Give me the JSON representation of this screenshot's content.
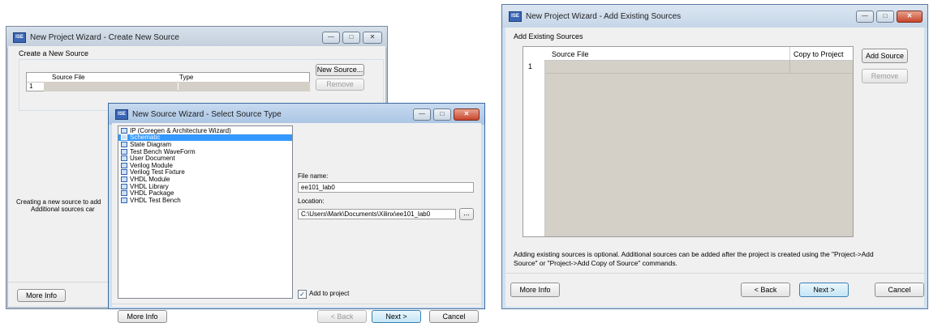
{
  "left_window": {
    "title": "New Project Wizard - Create New Source",
    "section_title": "Create a New Source",
    "table": {
      "row_number": "1",
      "col_source_file": "Source File",
      "col_type": "Type"
    },
    "new_source_label": "New Source...",
    "remove_label": "Remove",
    "info_line1": "Creating a new source to add",
    "info_line2": "Additional sources car",
    "more_info_label": "More Info"
  },
  "source_wizard": {
    "title": "New Source Wizard - Select Source Type",
    "types": [
      "IP (Coregen & Architecture Wizard)",
      "Schematic",
      "State Diagram",
      "Test Bench WaveForm",
      "User Document",
      "Verilog Module",
      "Verilog Test Fixture",
      "VHDL Module",
      "VHDL Library",
      "VHDL Package",
      "VHDL Test Bench"
    ],
    "selected_index": 1,
    "file_name_label": "File name:",
    "file_name_value": "ee101_lab0",
    "location_label": "Location:",
    "location_value": "C:\\Users\\Mark\\Documents\\Xilinx\\ee101_lab0",
    "browse_label": "...",
    "add_to_project_label": "Add to project",
    "add_to_project_checked": true,
    "more_info_label": "More Info",
    "back_label": "< Back",
    "next_label": "Next >",
    "cancel_label": "Cancel"
  },
  "right_window": {
    "title": "New Project Wizard - Add Existing Sources",
    "section_title": "Add Existing Sources",
    "table": {
      "row_number": "1",
      "col_source_file": "Source File",
      "col_copy": "Copy to Project"
    },
    "add_source_label": "Add Source",
    "remove_label": "Remove",
    "info_line1": "Adding existing sources is optional. Additional sources can be added after the project is created using the \"Project->Add",
    "info_line2": "Source\" or \"Project->Add Copy of Source\" commands.",
    "more_info_label": "More Info",
    "back_label": "< Back",
    "next_label": "Next >",
    "cancel_label": "Cancel"
  }
}
